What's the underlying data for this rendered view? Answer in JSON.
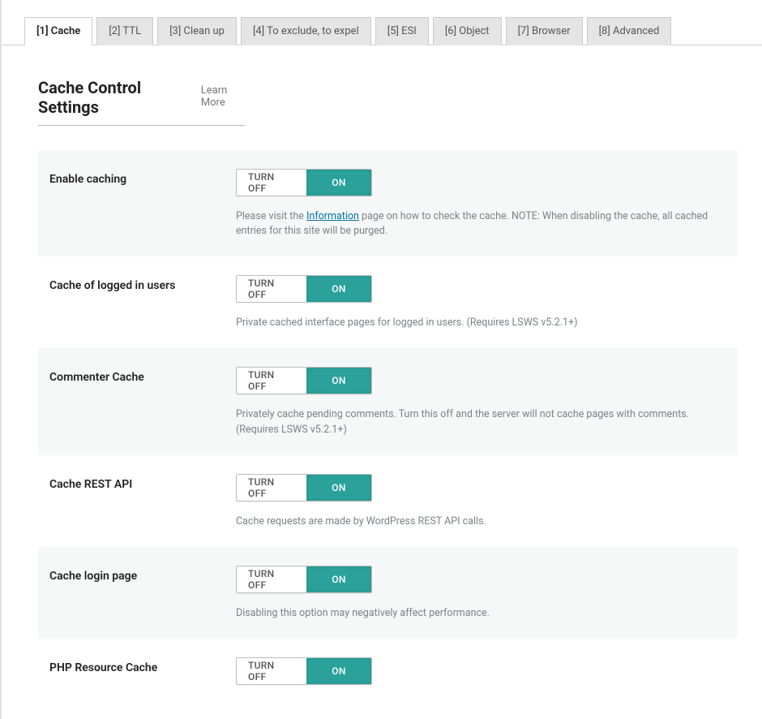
{
  "tabs": [
    {
      "label": "[1] Cache",
      "active": true
    },
    {
      "label": "[2] TTL",
      "active": false
    },
    {
      "label": "[3] Clean up",
      "active": false
    },
    {
      "label": "[4] To exclude, to expel",
      "active": false
    },
    {
      "label": "[5] ESI",
      "active": false
    },
    {
      "label": "[6] Object",
      "active": false
    },
    {
      "label": "[7] Browser",
      "active": false
    },
    {
      "label": "[8] Advanced",
      "active": false
    }
  ],
  "heading": "Cache Control Settings",
  "learn_more": "Learn More",
  "toggle": {
    "off": "TURN OFF",
    "on": "ON"
  },
  "settings": [
    {
      "label": "Enable caching",
      "desc_prefix": "Please visit the ",
      "desc_link": "Information",
      "desc_suffix": " page on how to check the cache. NOTE: When disabling the cache, all cached entries for this site will be purged.",
      "alt": true
    },
    {
      "label": "Cache of logged in users",
      "desc": "Private cached interface pages for logged in users. (Requires LSWS v5.2.1+)",
      "alt": false
    },
    {
      "label": "Commenter Cache",
      "desc": "Privately cache pending comments. Turn this off and the server will not cache pages with comments. (Requires LSWS v5.2.1+)",
      "alt": true
    },
    {
      "label": "Cache REST API",
      "desc": "Cache requests are made by WordPress REST API calls.",
      "alt": false
    },
    {
      "label": "Cache login page",
      "desc": "Disabling this option may negatively affect performance.",
      "alt": true
    },
    {
      "label": "PHP Resource Cache",
      "desc": "",
      "alt": false
    }
  ]
}
